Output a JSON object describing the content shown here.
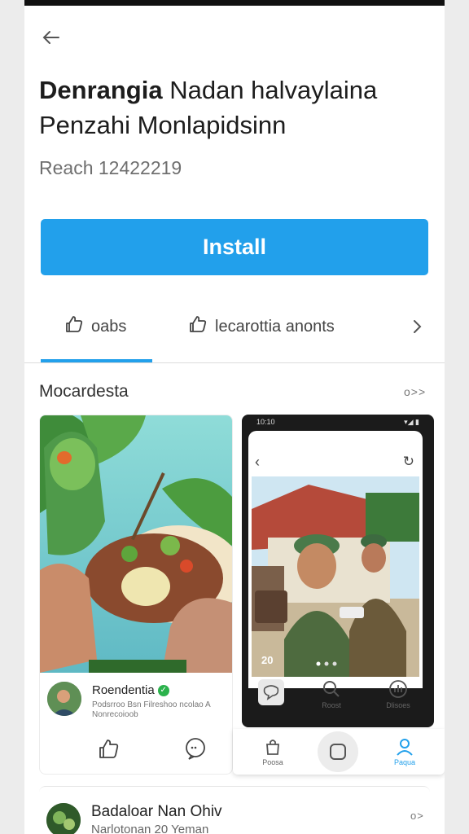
{
  "header": {
    "title_bold": "Denrangia",
    "title_rest": " Nadan halvaylaina Penzahi Monlapidsinn",
    "reach": "Reach 12422219"
  },
  "install_label": "Install",
  "tabs": [
    {
      "label": "oabs"
    },
    {
      "label": "lecarottia anonts"
    }
  ],
  "section": {
    "title": "Mocardesta",
    "more": "o>>"
  },
  "post1": {
    "author": "Roendentia",
    "subtext": "Podsrroo Bsn Filreshoo ncolao A Nonrecoioob"
  },
  "phone": {
    "status_time": "10:10",
    "photo_count": "20",
    "nav": [
      {
        "label": ""
      },
      {
        "label": "Roost"
      },
      {
        "label": "Dlisoes"
      }
    ]
  },
  "bottom_nav": [
    {
      "label": "Poosa"
    },
    {
      "label": ""
    },
    {
      "label": "Paqua"
    }
  ],
  "post2": {
    "name": "Badaloar Nan Ohiv",
    "meta": "Narlotonan 20 Yeman",
    "more": "o>"
  },
  "colors": {
    "accent": "#22a0eb",
    "verified": "#2bb24c"
  }
}
